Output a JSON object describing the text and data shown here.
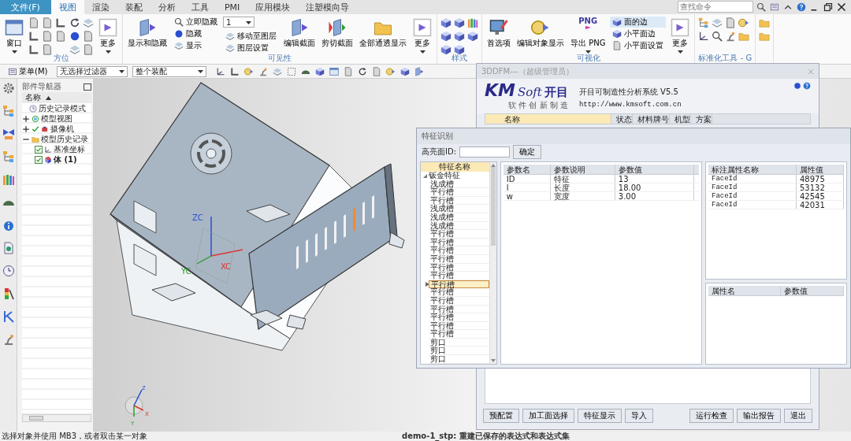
{
  "menu_bar": {
    "tabs": [
      {
        "label": "文件(F)",
        "kind": "file",
        "selected": false
      },
      {
        "label": "视图",
        "kind": "tab",
        "selected": true
      },
      {
        "label": "渲染",
        "kind": "tab",
        "selected": false
      },
      {
        "label": "装配",
        "kind": "tab",
        "selected": false
      },
      {
        "label": "分析",
        "kind": "tab",
        "selected": false
      },
      {
        "label": "工具",
        "kind": "tab",
        "selected": false
      },
      {
        "label": "PMI",
        "kind": "tab",
        "selected": false
      },
      {
        "label": "应用模块",
        "kind": "tab",
        "selected": false
      },
      {
        "label": "注塑模向导",
        "kind": "tab",
        "selected": false
      }
    ],
    "search": {
      "placeholder": "查找命令"
    }
  },
  "ribbon": {
    "groups": [
      {
        "label": "方位",
        "items": [
          {
            "kind": "large",
            "label": "窗口",
            "dropdown": true
          },
          {
            "kind": "grid"
          },
          {
            "kind": "grid"
          },
          {
            "kind": "large",
            "label": "更多",
            "dropdown": true
          }
        ]
      },
      {
        "label": "可见性",
        "items": [
          {
            "kind": "large",
            "label": "显示和隐藏",
            "dropdown": false
          },
          {
            "kind": "list",
            "entries": [
              {
                "label": "立即隐藏"
              },
              {
                "label": "隐藏"
              },
              {
                "label": "显示"
              }
            ]
          },
          {
            "kind": "stack",
            "select": "1",
            "entries": [
              {
                "label": "移动至图层"
              },
              {
                "label": "图层设置"
              }
            ]
          },
          {
            "kind": "large",
            "label": "编辑截面",
            "dropdown": false
          },
          {
            "kind": "large",
            "label": "剪切截面",
            "dropdown": false
          },
          {
            "kind": "large",
            "label": "全部通透显示",
            "dropdown": false
          },
          {
            "kind": "large",
            "label": "更多",
            "dropdown": true
          }
        ]
      },
      {
        "label": "样式",
        "items": [
          {
            "kind": "grid"
          }
        ]
      },
      {
        "label": "可视化",
        "items": [
          {
            "kind": "large",
            "label": "首选项",
            "dropdown": false
          },
          {
            "kind": "large",
            "label": "编辑对象显示",
            "dropdown": false
          },
          {
            "kind": "large",
            "label": "导出 PNG",
            "icon_text": "PNG",
            "dropdown": true
          },
          {
            "kind": "list",
            "entries": [
              {
                "label": "面的边",
                "selected": true
              },
              {
                "label": "小平面边",
                "selected": false
              },
              {
                "label": "小平面设置",
                "selected": false
              }
            ]
          },
          {
            "kind": "large",
            "label": "更多",
            "dropdown": true
          }
        ]
      },
      {
        "label": "标准化工具 - G",
        "items": [
          {
            "kind": "grid"
          }
        ]
      },
      {
        "items": [
          {
            "kind": "grid"
          }
        ]
      }
    ]
  },
  "toolbar": {
    "menu": "菜单(M)",
    "filters": [
      {
        "value": "无选择过滤器"
      },
      {
        "value": "整个装配"
      }
    ]
  },
  "navigator": {
    "title": "部件导航器",
    "column": "名称",
    "tree": [
      {
        "label": "历史记录模式",
        "kind": "clock"
      },
      {
        "label": "模型视图",
        "kind": "view",
        "expanded": false
      },
      {
        "label": "摄像机",
        "kind": "camera",
        "expanded": false,
        "checked": true
      },
      {
        "label": "模型历史记录",
        "kind": "folder",
        "expanded": true,
        "children": [
          {
            "label": "基准坐标",
            "kind": "csys",
            "checked": true
          },
          {
            "label": "体 (1)",
            "kind": "body",
            "checked": true
          }
        ]
      }
    ]
  },
  "viewport": {
    "axis_labels": [
      "ZC",
      "XC",
      "YC"
    ],
    "triad_labels": [
      "Z",
      "X",
      "Y"
    ]
  },
  "dfm_window": {
    "title": "3DDFM---（超级管理员）",
    "logo": {
      "mark": "KM",
      "word": "Soft",
      "brand": "开目",
      "slogan": "软 件 创 新 制 造"
    },
    "product": "开目可制造性分析系统 V5.5",
    "url": "http://www.kmsoft.com.cn",
    "columns": [
      "名称",
      "状态",
      "材料牌号",
      "机型",
      "方案"
    ],
    "left_buttons": [
      "预配置",
      "加工面选择",
      "特征显示",
      "导入"
    ],
    "right_buttons": [
      "运行检查",
      "输出报告",
      "退出"
    ]
  },
  "feature_dialog": {
    "title": "特征识别",
    "highlight_label": "高亮面ID:",
    "confirm": "确定",
    "tree": {
      "header": "特征名称",
      "root": "钣金特征",
      "expanded": true,
      "children": [
        {
          "label": "浅成槽",
          "selected": false
        },
        {
          "label": "平行槽",
          "selected": false
        },
        {
          "label": "平行槽",
          "selected": false
        },
        {
          "label": "浅成槽",
          "selected": false
        },
        {
          "label": "浅成槽",
          "selected": false
        },
        {
          "label": "浅成槽",
          "selected": false
        },
        {
          "label": "平行槽",
          "selected": false
        },
        {
          "label": "平行槽",
          "selected": false
        },
        {
          "label": "平行槽",
          "selected": false
        },
        {
          "label": "平行槽",
          "selected": false
        },
        {
          "label": "平行槽",
          "selected": false
        },
        {
          "label": "平行槽",
          "selected": false
        },
        {
          "label": "平行槽",
          "selected": true
        },
        {
          "label": "平行槽",
          "selected": false
        },
        {
          "label": "平行槽",
          "selected": false
        },
        {
          "label": "平行槽",
          "selected": false
        },
        {
          "label": "平行槽",
          "selected": false
        },
        {
          "label": "平行槽",
          "selected": false
        },
        {
          "label": "平行槽",
          "selected": false
        },
        {
          "label": "剪口",
          "selected": false
        },
        {
          "label": "剪口",
          "selected": false
        },
        {
          "label": "剪口",
          "selected": false
        }
      ]
    },
    "params": {
      "columns": [
        "参数名",
        "参数说明",
        "参数值"
      ],
      "rows": [
        [
          "ID",
          "特征",
          "13"
        ],
        [
          "l",
          "长度",
          "18.00"
        ],
        [
          "w",
          "宽度",
          "3.00"
        ]
      ]
    },
    "annotations": {
      "columns": [
        "标注属性名称",
        "属性值"
      ],
      "rows": [
        [
          "FaceId",
          "48975"
        ],
        [
          "FaceId",
          "53132"
        ],
        [
          "FaceId",
          "42545"
        ],
        [
          "FaceId",
          "42031"
        ]
      ]
    },
    "attributes": {
      "columns": [
        "属性名",
        "参数值"
      ]
    }
  },
  "status_bar": {
    "prompt": "选择对象并使用 MB3，或者双击某一对象",
    "message": "demo-1_stp: 重建已保存的表达式和表达式集"
  }
}
